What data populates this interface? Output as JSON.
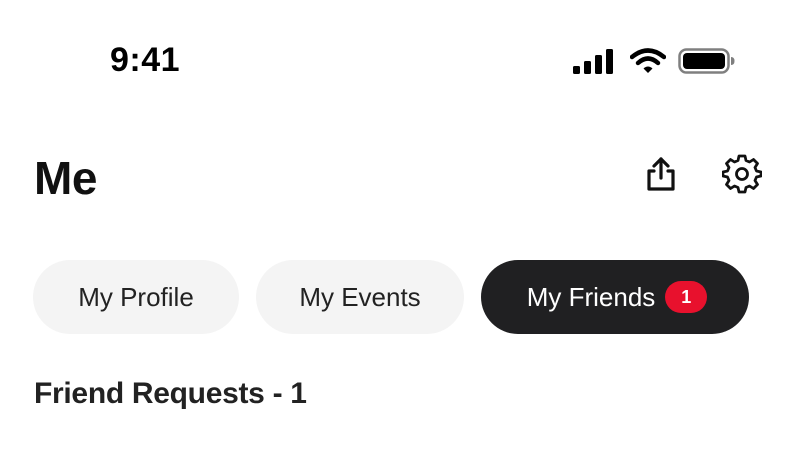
{
  "status_bar": {
    "time": "9:41",
    "icons": [
      "signal-icon",
      "wifi-icon",
      "battery-icon"
    ]
  },
  "header": {
    "title": "Me",
    "actions": [
      "share-icon",
      "gear-icon"
    ]
  },
  "tabs": [
    {
      "label": "My Profile",
      "selected": false
    },
    {
      "label": "My Events",
      "selected": false
    },
    {
      "label": "My Friends",
      "selected": true,
      "badge": "1"
    }
  ],
  "section": {
    "heading": "Friend Requests - 1"
  },
  "colors": {
    "active_tab_bg": "#202022",
    "inactive_tab_bg": "#f4f4f4",
    "badge": "#e8112d"
  }
}
